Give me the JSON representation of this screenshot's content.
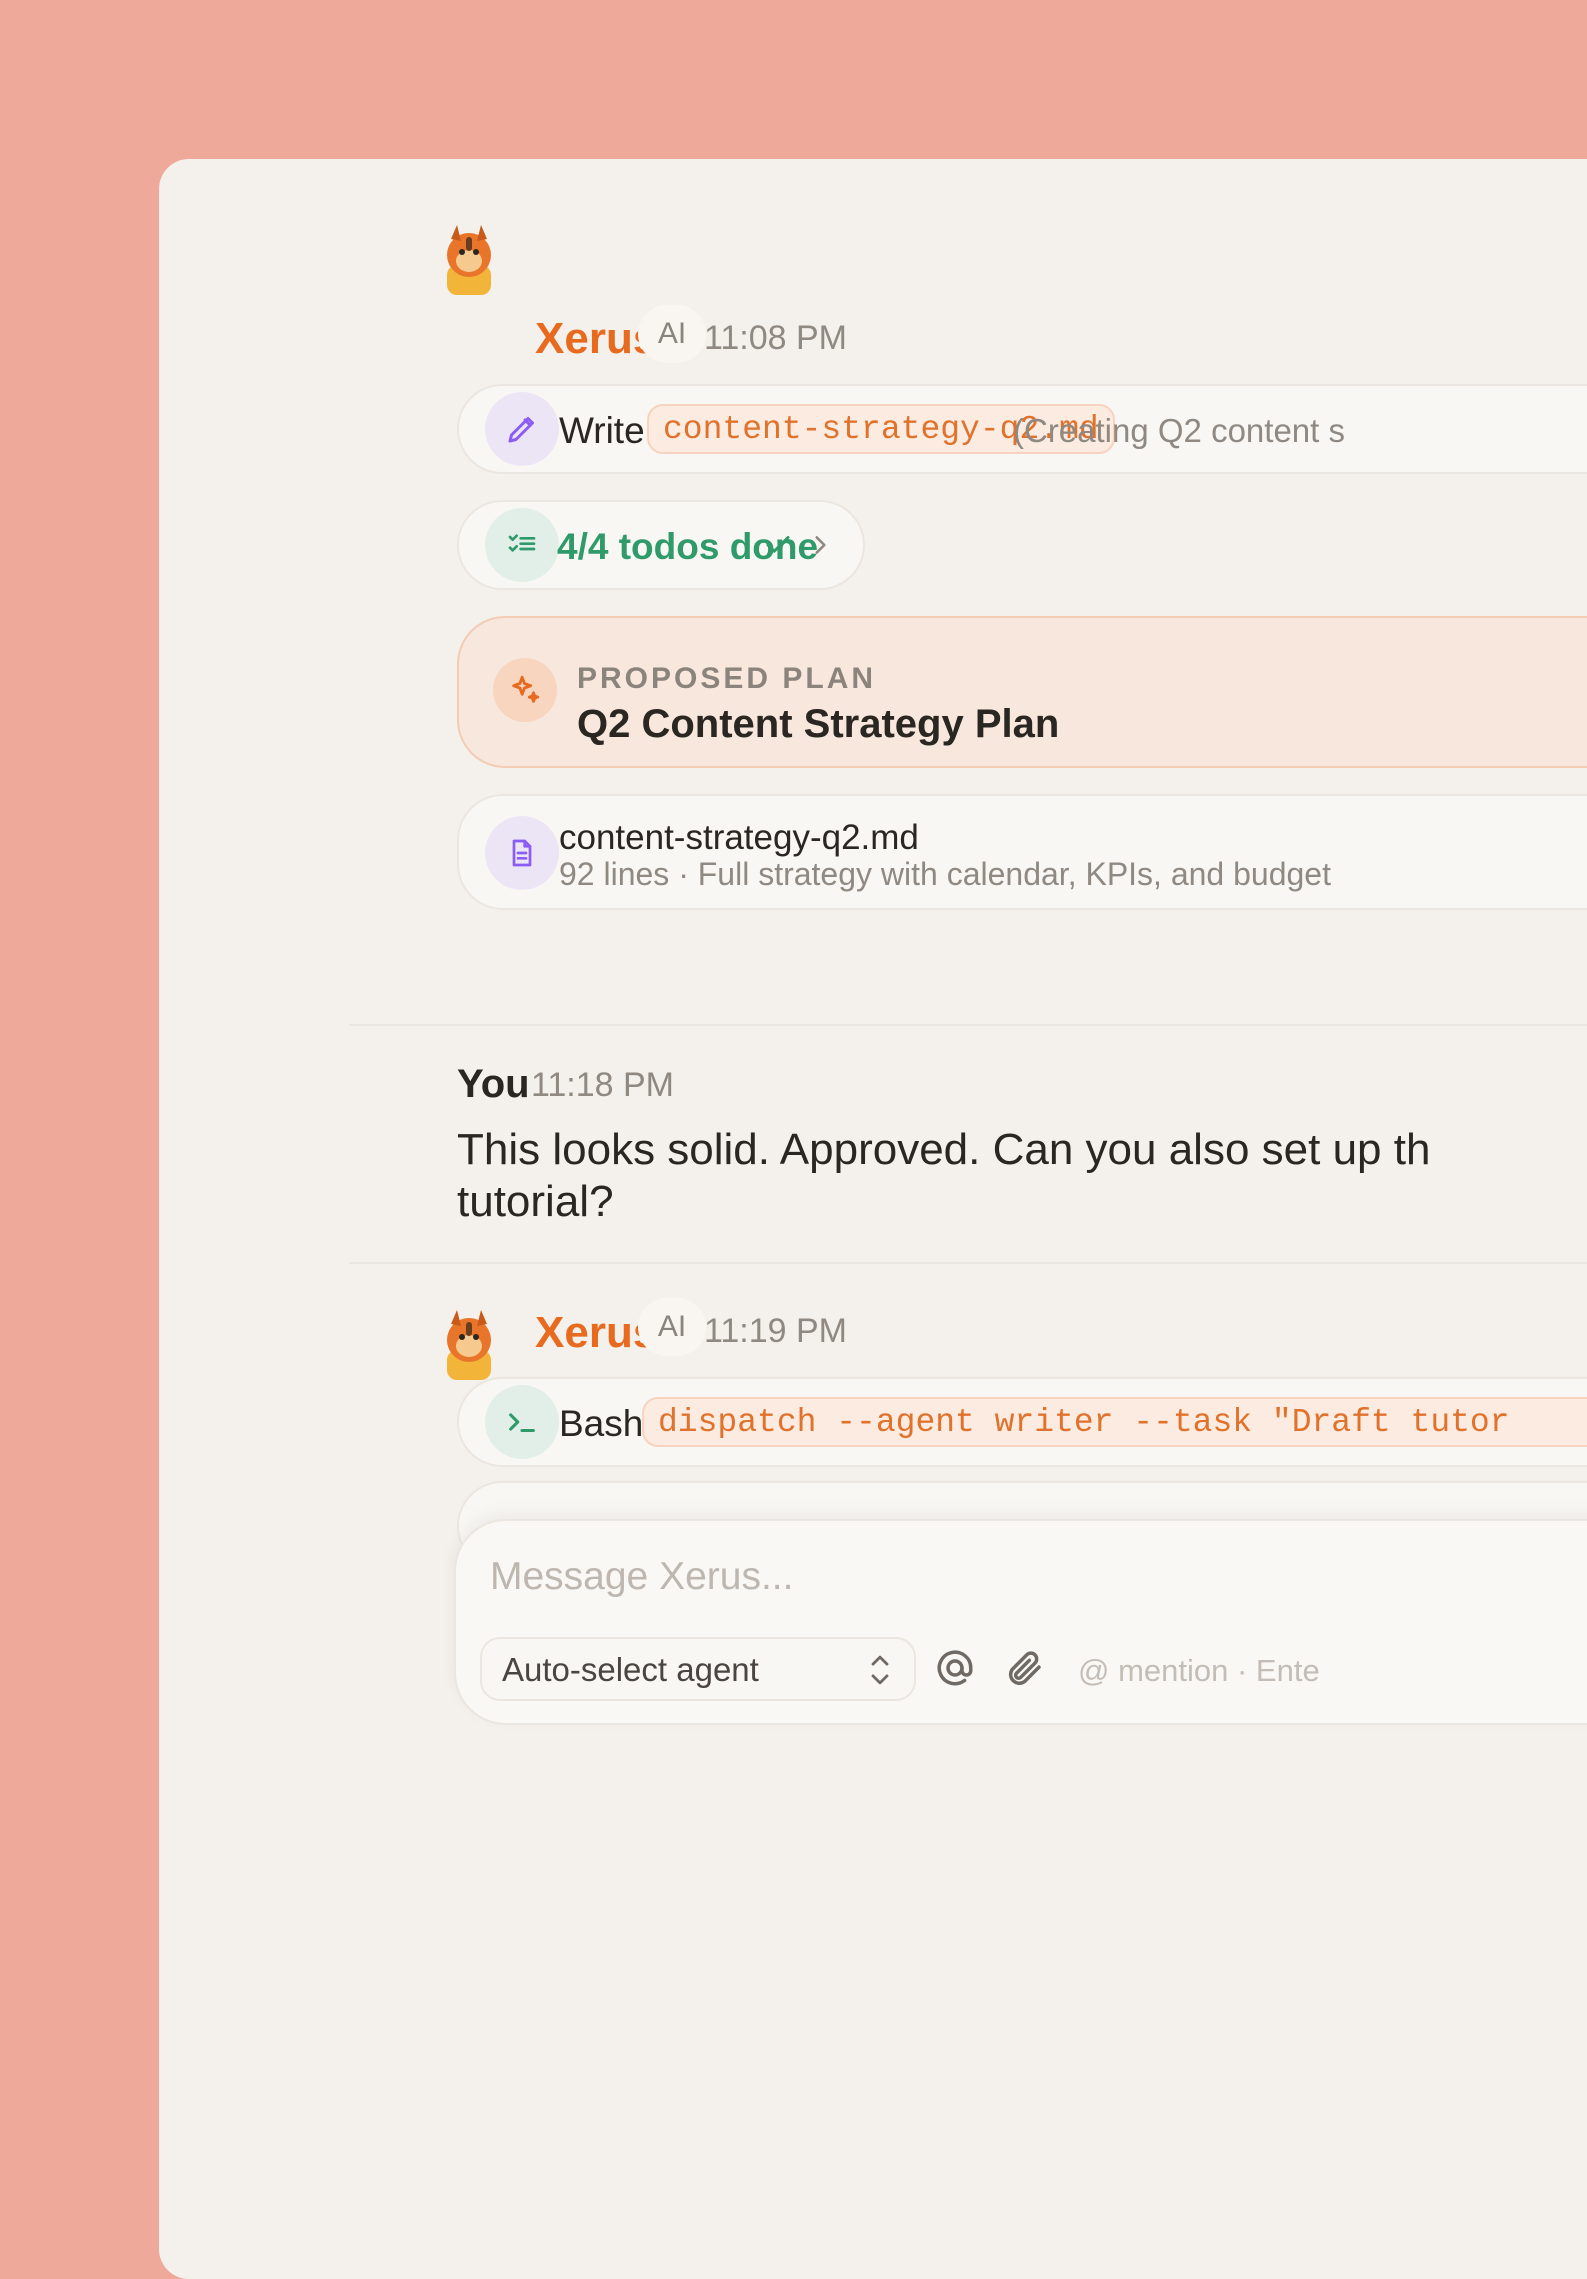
{
  "messages": [
    {
      "sender": "Xerus",
      "badge": "AI",
      "time": "11:08 PM",
      "tool": {
        "name": "Write",
        "arg": "content-strategy-q2.md",
        "note": "(Creating Q2 content s"
      },
      "todos": {
        "label": "4/4 todos done"
      },
      "plan": {
        "kicker": "PROPOSED PLAN",
        "title": "Q2 Content Strategy Plan"
      },
      "file": {
        "name": "content-strategy-q2.md",
        "meta": "92 lines · Full strategy with calendar, KPIs, and budget"
      }
    },
    {
      "sender": "You",
      "time": "11:18 PM",
      "text_line1": "This looks solid. Approved. Can you also set up th",
      "text_line2": "tutorial?"
    },
    {
      "sender": "Xerus",
      "badge": "AI",
      "time": "11:19 PM",
      "tool": {
        "name": "Bash",
        "arg": "dispatch --agent writer --task \"Draft tutor"
      }
    }
  ],
  "composer": {
    "placeholder": "Message Xerus...",
    "agent_select": "Auto-select agent",
    "hint": "@ mention · Ente"
  },
  "colors": {
    "background": "#eea99b",
    "panel": "#f4f0eb",
    "accent": "#e86a1f",
    "success": "#2f9a6a",
    "purple": "#8b5cf6"
  }
}
